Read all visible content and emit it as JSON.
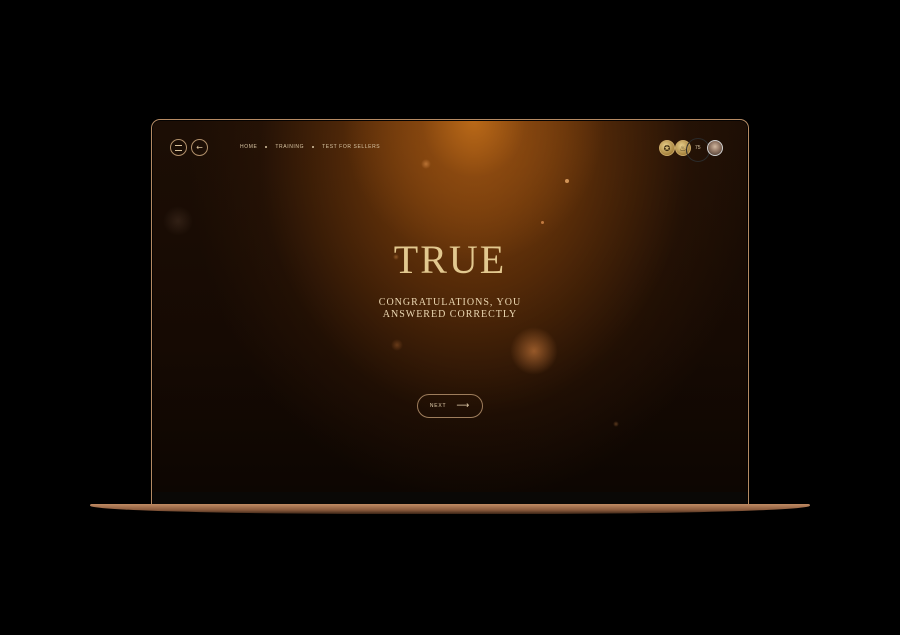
{
  "nav": {
    "items": [
      {
        "label": "HOME"
      },
      {
        "label": "TRAINING"
      },
      {
        "label": "TEST FOR SELLERS"
      }
    ]
  },
  "icons": {
    "menu": "hamburger-icon",
    "back": "arrow-left-icon",
    "badges": [
      "achievement-badge-icon",
      "flame-badge-icon"
    ],
    "next_arrow": "arrow-right-icon"
  },
  "user": {
    "score": "75"
  },
  "result": {
    "title": "TRUE",
    "message_line1": "CONGRATULATIONS, YOU",
    "message_line2": "ANSWERED CORRECTLY"
  },
  "actions": {
    "next_label": "NEXT"
  },
  "colors": {
    "accent_gold": "#e2c88f",
    "background": "#000000",
    "glow": "#8b480e",
    "laptop_bezel": "#b58a63"
  }
}
